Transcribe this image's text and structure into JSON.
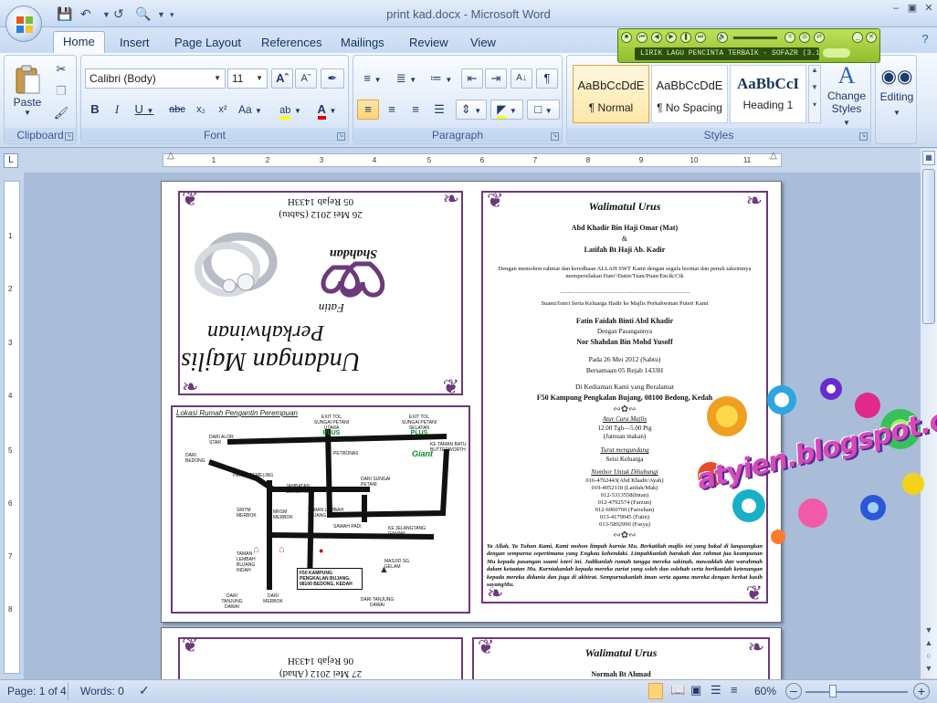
{
  "window": {
    "title": "print kad.docx - Microsoft Word"
  },
  "tabs": [
    "Home",
    "Insert",
    "Page Layout",
    "References",
    "Mailings",
    "Review",
    "View"
  ],
  "ribbon": {
    "clipboard": {
      "label": "Clipboard",
      "paste": "Paste"
    },
    "font": {
      "label": "Font",
      "name": "Calibri (Body)",
      "size": "11"
    },
    "paragraph": {
      "label": "Paragraph"
    },
    "styles": {
      "label": "Styles",
      "items": [
        {
          "sample": "AaBbCcDdE",
          "name": "¶ Normal"
        },
        {
          "sample": "AaBbCcDdE",
          "name": "¶ No Spacing"
        },
        {
          "sample": "AaBbCcI",
          "name": "Heading 1"
        }
      ],
      "change_styles": "Change Styles"
    },
    "editing": {
      "label": "Editing"
    }
  },
  "player": {
    "ticker": "LIRIK LAGU PENCINTA TERBAIK - SOFAZR (3.19)"
  },
  "ruler": [
    "1",
    "2",
    "3",
    "4",
    "5",
    "6",
    "7",
    "8",
    "9",
    "10",
    "11"
  ],
  "vruler": [
    "1",
    "2",
    "3",
    "4",
    "5",
    "6",
    "7",
    "8"
  ],
  "card": {
    "cover_date": "26 Mei 2012 (Sabtu)",
    "cover_hijri": "05 Rejab 1433H",
    "cover_name1": "Shahdan",
    "cover_name2": "Fatin",
    "cover_title1": "Undangan Majlis",
    "cover_title2": "Perkahwinan",
    "map_title": "Lokasi Rumah Pengantin Perempuan",
    "map_labels": [
      "EXIT TOL",
      "PLUS",
      "SUNGAI PETANI UTARA",
      "SUNGAI PETANI SELATAN",
      "KE TAMAN BATU",
      "BUTTERWORTH",
      "DARI ALOR STAR",
      "DARI BEDONG",
      "PETRONAS",
      "Giant",
      "PEKAN SEMELING",
      "DARI SUNGAI PETANI",
      "JAMBATAN SEMELING",
      "SRITM MERBOK",
      "MRSM MERBOK",
      "TAMAN LEMBAH BUJANG UTAMA",
      "SAWAH PADI",
      "KE JELANGTANG GANAM",
      "TAMAN LEMBAH BUJANG INDAH",
      "MASJID SG. GELAM",
      "F50 KAMPUNG PENGKALAN BUJANG, 08100 BEDONG, KEDAH",
      "DARI TANJUNG DAWAI",
      "DARI MERBOK"
    ],
    "heading": "Walimatul Urus",
    "parents1": "Abd Khadir Bin Haji Omar (Mat)",
    "amp": "&",
    "parents2": "Latifah Bt Haji  Ab. Kadir",
    "invite": "Dengan memohon rahmat dan keredhaan ALLAH SWT Kami dengan segala hormat dan penuh takzimnya mempersilakan Dato'/Datin/Tuan/Puan/Encik/Cik",
    "dots": "...............................................................................................",
    "invite2": "Suami/Isteri Serta Keluarga Hadir ke Majlis Perkahwinan Puteri Kami",
    "bride": "Fatin Faidah Binti Abd Khadir",
    "with": "Dengan Pasangannya",
    "groom": "Nor Shahdan Bin Mohd Yusoff",
    "date": "Pada 26 Mei 2012 (Sabtu)",
    "hijri": "Bersamaan 05 Rejab 1433H",
    "venue_intro": "Di Kediaman Kami yang Beralamat",
    "venue": "F50 Kampung Pengkalan Bujang, 08100 Bedong, Kedah",
    "agenda_h": "Atur Cara Majlis",
    "agenda": "12.00 Tgh—5.00 Ptg",
    "agenda2": "(Jamuan makan)",
    "guests_h": "Turut mengundang",
    "guests": "Seisi Keluarga",
    "phones_h": "Nombor Untuk Dihubungi",
    "phones": [
      "016-4762443(Abd Khadir/Ayah)",
      "019-4052118 (Latifah/Mak)",
      "012-5313558(Intan)",
      "012-4792574 (Farzun)",
      "012-6960760 (Farzehan)",
      "013-4179045 (Fatin)",
      "013-5892990 (Fasya)"
    ],
    "prayer": "Ya Allah, Ya Tuhan Kami, Kami mohon limpah kurnia Mu. Berkatilah majlis ini yang bakal di langsungkan dengan sempurna sepertimana yang Engkau kehendaki. Limpahkanlah barakah dan rahmat jua keampunan Mu kepada pasangan suami isteri ini. Jadikanlah rumah tangga mereka sakinah, mawaddah dan warahmah dalam ketaatan Mu. Kurniakanlah kepada mereka zuriat yang soleh dan solehah serta berikanlah ketenangan kepada mereka didunia dan juga di akhirat. Sempurnakanlah iman serta agama mereka dengan berkat kasih sayangMu.",
    "p2_date": "27 Mei 2012 (Ahad)",
    "p2_hijri": "06 Rejab 1433H",
    "p2_heading": "Walimatul Urus",
    "p2_parent": "Normah Bt Ahmad"
  },
  "watermark": "atyien.blogspot.com",
  "status": {
    "page": "Page: 1 of 4",
    "words": "Words: 0",
    "zoom": "60%"
  },
  "colors": {
    "accent_purple": "#6c3a7a",
    "ribbon_blue": "#dce8f7"
  }
}
